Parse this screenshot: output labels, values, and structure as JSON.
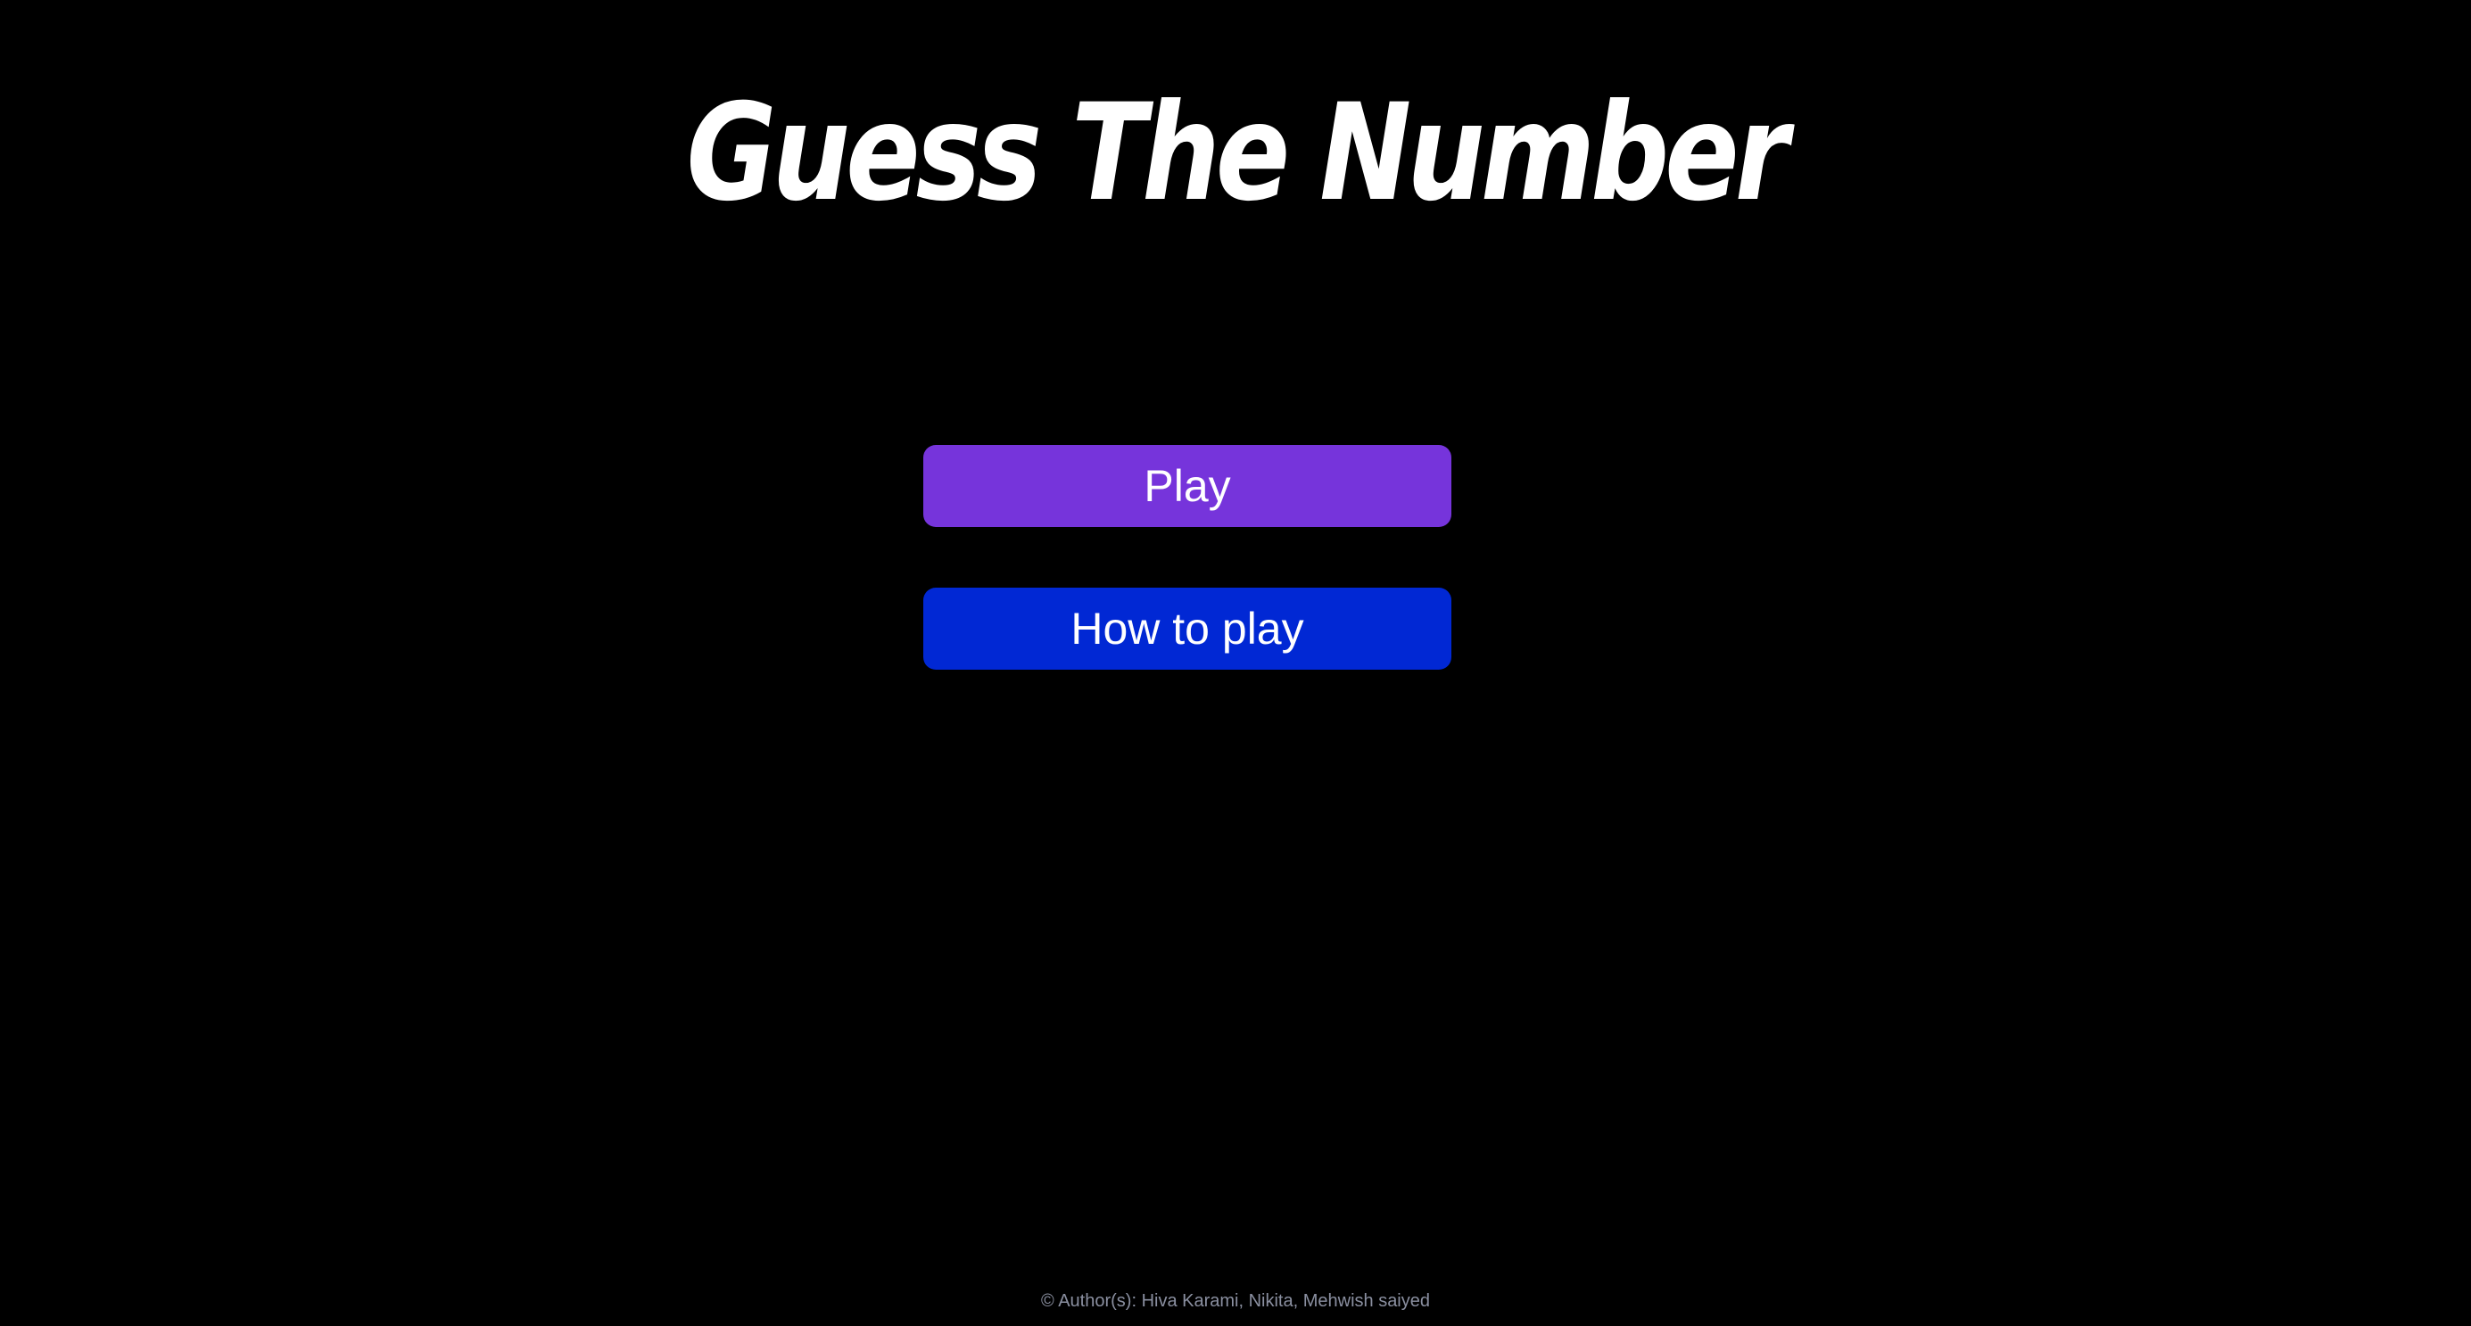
{
  "title": "Guess The Number",
  "menu": {
    "play_label": "Play",
    "how_to_play_label": "How to play"
  },
  "footer": {
    "copyright_symbol": "©",
    "authors_text": "Author(s): Hiva Karami, Nikita, Mehwish saiyed"
  },
  "colors": {
    "background": "#000000",
    "play_button": "#7634db",
    "how_to_play_button": "#0128d4",
    "title_text": "#ffffff",
    "footer_text": "#8a8fa0"
  }
}
